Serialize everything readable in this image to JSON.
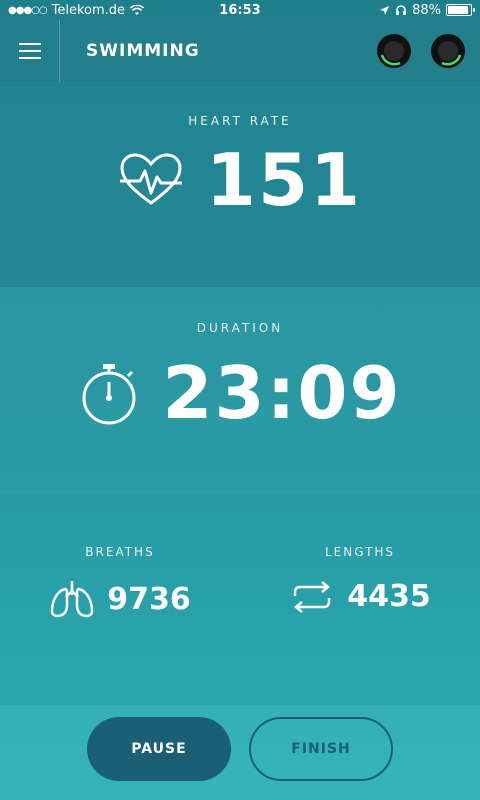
{
  "status_bar": {
    "carrier": "Telekom.de",
    "time": "16:53",
    "battery": "88%"
  },
  "header": {
    "title": "SWIMMING"
  },
  "heart_rate": {
    "label": "HEART RATE",
    "value": "151"
  },
  "duration": {
    "label": "DURATION",
    "value": "23:09"
  },
  "breaths": {
    "label": "BREATHS",
    "value": "9736"
  },
  "lengths": {
    "label": "LENGTHS",
    "value": "4435"
  },
  "controls": {
    "pause_label": "PAUSE",
    "finish_label": "FINISH"
  },
  "colors": {
    "background": "#2a98a3",
    "header": "#237f8b",
    "pause_button": "#1a5f73",
    "text": "#ffffff"
  },
  "icons": [
    "wifi-icon",
    "location-icon",
    "headphones-icon",
    "battery-icon",
    "menu-icon",
    "earbud-icon",
    "heart-rate-icon",
    "stopwatch-icon",
    "lungs-icon",
    "repeat-icon"
  ]
}
